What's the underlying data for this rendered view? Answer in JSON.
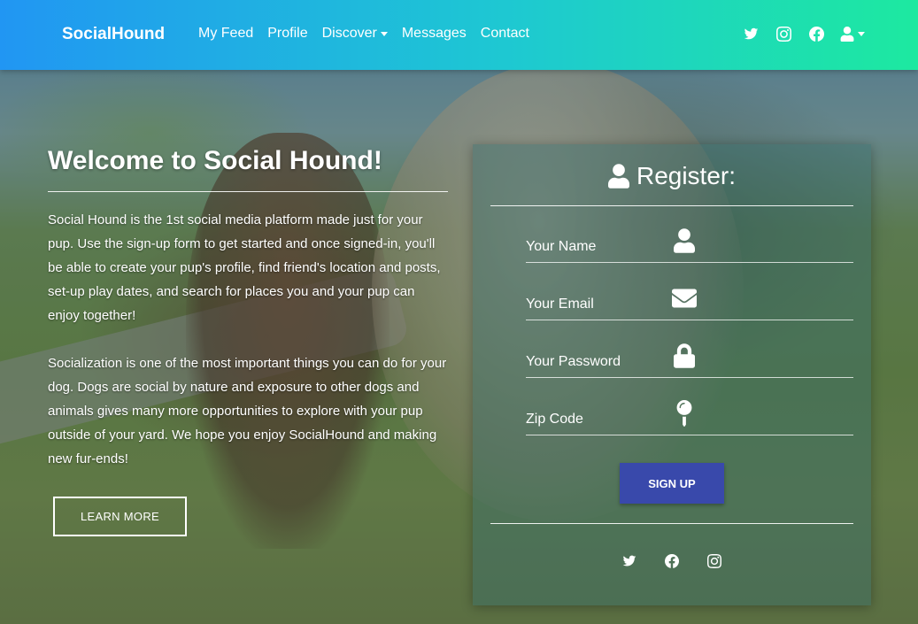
{
  "nav": {
    "brand": "SocialHound",
    "links": [
      "My Feed",
      "Profile",
      "Discover",
      "Messages",
      "Contact"
    ],
    "icons": [
      "twitter-icon",
      "instagram-icon",
      "facebook-icon",
      "user-icon"
    ]
  },
  "hero": {
    "title": "Welcome to Social Hound!",
    "paragraphs": [
      "Social Hound is the 1st social media platform made just for your pup. Use the sign-up form to get started and once signed-in, you'll be able to create your pup's profile, find friend's location and posts, set-up play dates, and search for places you and your pup can enjoy together!",
      "Socialization is one of the most important things you can do for your dog. Dogs are social by nature and exposure to other dogs and animals gives many more opportunities to explore with your pup outside of your yard. We hope you enjoy SocialHound and making new fur-ends!"
    ],
    "learn_more_label": "Learn more"
  },
  "register": {
    "title": "Register:",
    "fields": [
      {
        "placeholder": "Your Name",
        "icon": "user-icon"
      },
      {
        "placeholder": "Your Email",
        "icon": "envelope-icon"
      },
      {
        "placeholder": "Your Password",
        "icon": "lock-icon"
      },
      {
        "placeholder": "Zip Code",
        "icon": "map-pin-icon"
      }
    ],
    "signup_label": "Sign up",
    "social_icons": [
      "twitter-icon",
      "facebook-icon",
      "instagram-icon"
    ]
  },
  "colors": {
    "navbar_start": "#2196f3",
    "navbar_end": "#1de9a0",
    "signup_button": "#3949ab"
  }
}
